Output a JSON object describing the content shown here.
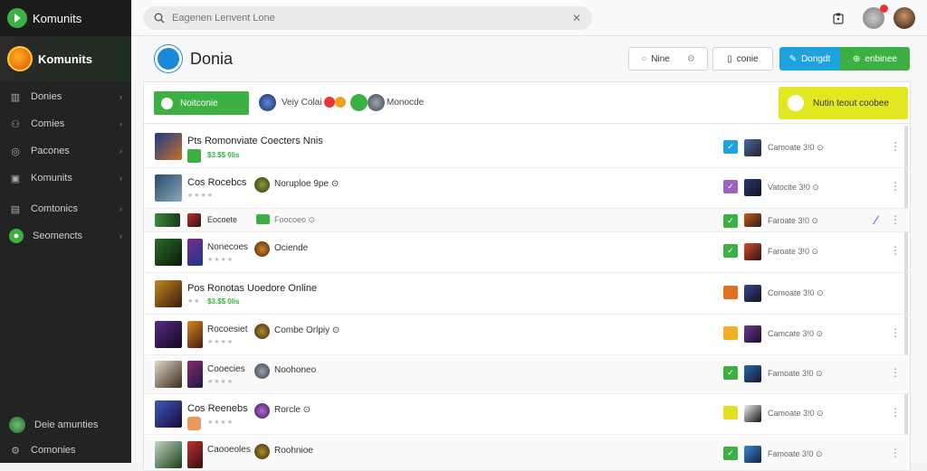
{
  "app": {
    "title": "Komunits",
    "brand": "Komunits"
  },
  "sidebar": {
    "items": [
      {
        "label": "Donies",
        "icon": "grid-icon"
      },
      {
        "label": "Comies",
        "icon": "people-icon"
      },
      {
        "label": "Pacones",
        "icon": "target-icon"
      },
      {
        "label": "Komunits",
        "icon": "calendar-icon"
      },
      {
        "label": "Comtonics",
        "icon": "message-icon"
      },
      {
        "label": "Seomencts",
        "icon": "chat-icon"
      }
    ],
    "bottom": [
      {
        "label": "Deie amunties"
      },
      {
        "label": "Comonies"
      }
    ]
  },
  "topbar": {
    "search_placeholder": "Eagenen Lenvent Lone"
  },
  "header": {
    "title": "Donia",
    "btn_nine": "Nine",
    "btn_conie": "conie",
    "btn_dongdt": "Dongdt",
    "btn_enbinee": "enbinee"
  },
  "filters": {
    "green_label": "Noitconie",
    "people_text": "Veiy Colai",
    "recent_text": "Monocde",
    "yellow_label": "Nutin teout coobee"
  },
  "rows": [
    {
      "title": "Pts Romonviate Coecters Nnis",
      "sub": "$3.$$ 0lis",
      "tag": "",
      "stat": "Camoate 3!0 ⊙"
    },
    {
      "title": "Cos Rocebcs",
      "sub": "",
      "tag": "Noruploe 9pe ⊙",
      "stat": "Vatocite 3!0 ⊙"
    },
    {
      "title": "Eocoete",
      "sub": "",
      "tag": "Foocoeo ⊙",
      "stat": "Faroate 3!0 ⊙"
    },
    {
      "title": "Nonecoes",
      "sub": "",
      "tag": "Ociende",
      "stat": "Faroate 3!0 ⊙"
    },
    {
      "title": "Pos Ronotas Uoedore Online",
      "sub": "$3.$$ 0lis",
      "tag": "",
      "stat": "Comoate 3!0 ⊙"
    },
    {
      "title": "Rocoesiet",
      "sub": "",
      "tag": "Combe Orlpiy ⊙",
      "stat": "Camcate 3!0 ⊙"
    },
    {
      "title": "Cooecies",
      "sub": "",
      "tag": "Noohoneo",
      "stat": "Famoate 3!0 ⊙"
    },
    {
      "title": "Cos Reenebs",
      "sub": "",
      "tag": "Rorcle ⊙",
      "stat": "Camoate 3!0 ⊙"
    },
    {
      "title": "Caooeoles",
      "sub": "",
      "tag": "Roohnioe",
      "stat": "Famoate 3!0 ⊙"
    }
  ],
  "colors": {
    "accent_green": "#3cb043",
    "accent_blue": "#1ea3df",
    "accent_yellow": "#e2e820"
  }
}
